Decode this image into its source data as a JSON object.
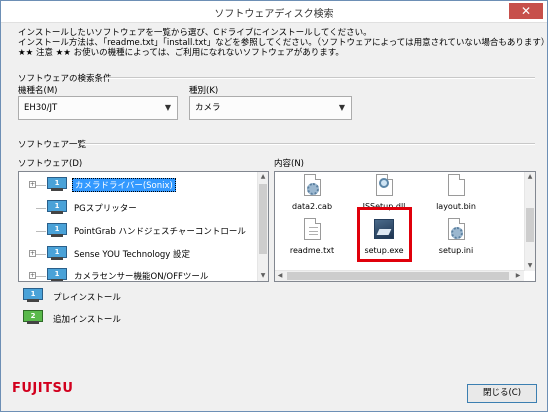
{
  "window": {
    "title": "ソフトウェアディスク検索",
    "close_glyph": "✕"
  },
  "notice": {
    "line1": "インストールしたいソフトウェアを一覧から選び、Cドライブにインストールしてください。",
    "line2": "インストール方法は、「readme.txt」「install.txt」などを参照してください。（ソフトウェアによっては用意されていない場合もあります）",
    "line3": "★★ 注意 ★★ お使いの機種によっては、ご利用になれないソフトウェアがあります。"
  },
  "search": {
    "section_label": "ソフトウェアの検索条件",
    "model_label": "機種名(M)",
    "model_value": "EH30/JT",
    "category_label": "種別(K)",
    "category_value": "カメラ"
  },
  "list": {
    "section_label": "ソフトウェア一覧",
    "software_label": "ソフトウェア(D)",
    "contents_label": "内容(N)",
    "software": [
      {
        "label": "カメラドライバー(Sonix)",
        "icon": "monitor-preinstall-icon",
        "selected": true,
        "expandable": true
      },
      {
        "label": "PGスプリッター",
        "icon": "monitor-preinstall-icon",
        "selected": false,
        "expandable": false
      },
      {
        "label": "PointGrab ハンドジェスチャーコントロール",
        "icon": "monitor-preinstall-icon",
        "selected": false,
        "expandable": false
      },
      {
        "label": "Sense YOU Technology 設定",
        "icon": "monitor-preinstall-icon",
        "selected": false,
        "expandable": true
      },
      {
        "label": "カメラセンサー機能ON/OFFツール",
        "icon": "monitor-preinstall-icon",
        "selected": false,
        "expandable": true
      }
    ],
    "files": [
      {
        "name": "data2.cab",
        "icon": "gear-file-icon"
      },
      {
        "name": "ISSetup.dll",
        "icon": "magnifier-file-icon"
      },
      {
        "name": "layout.bin",
        "icon": "blank-file-icon"
      },
      {
        "name": "readme.txt",
        "icon": "text-file-icon"
      },
      {
        "name": "setup.exe",
        "icon": "setup-exe-icon",
        "highlighted": true
      },
      {
        "name": "setup.ini",
        "icon": "gear-file-icon"
      }
    ]
  },
  "legend": {
    "preinstall_badge": "1",
    "preinstall_label": "プレインストール",
    "additional_badge": "2",
    "additional_label": "追加インストール"
  },
  "brand": {
    "logo": "FUJITSU"
  },
  "footer": {
    "close_button": "閉じる(C)"
  },
  "colors": {
    "selection": "#3399ff",
    "highlight_box": "#e0000b",
    "preinstall_icon": "#4aa2d8",
    "additional_icon": "#59b94b",
    "logo": "#d2001e"
  }
}
